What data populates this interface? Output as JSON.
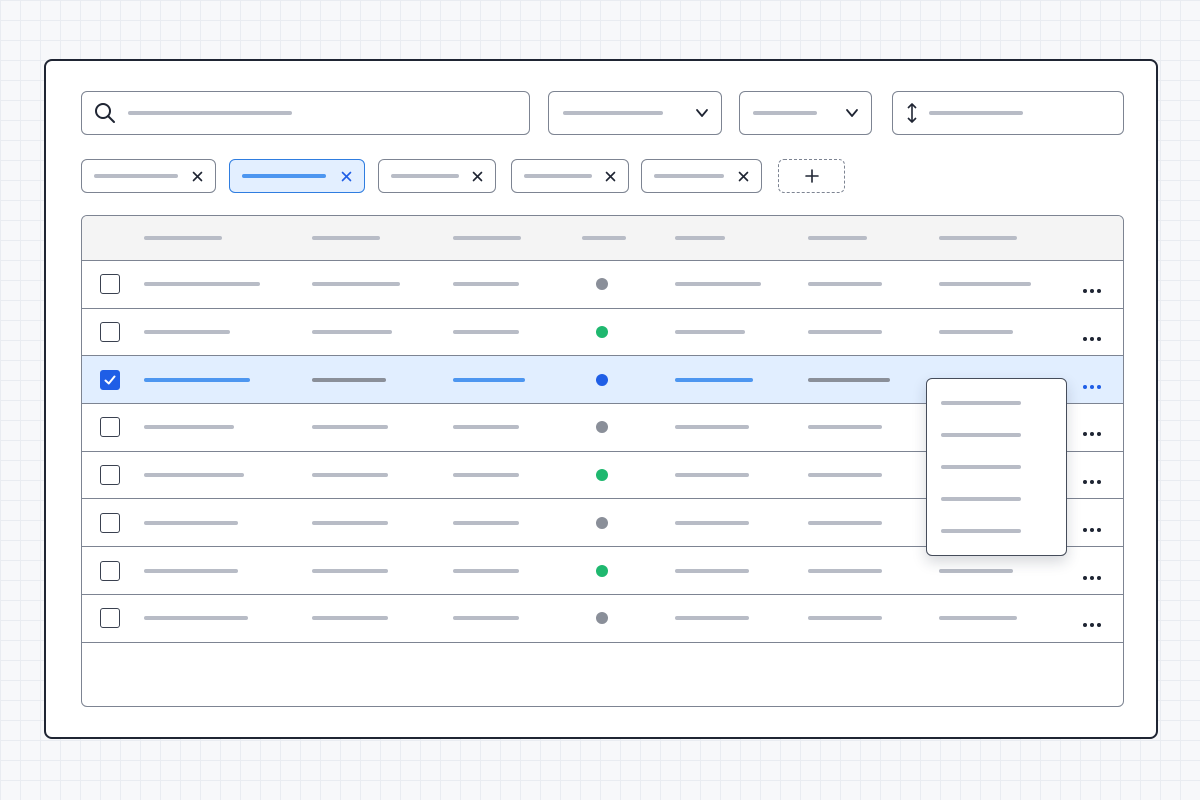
{
  "toolbar": {
    "search": {
      "icon": "search-icon",
      "value": ""
    },
    "filter_dropdown_1": {
      "icon": "chevron-down-icon",
      "value": ""
    },
    "filter_dropdown_2": {
      "icon": "chevron-down-icon",
      "value": ""
    },
    "sort_control": {
      "icon": "sort-arrows-icon",
      "value": ""
    }
  },
  "filter_chips": [
    {
      "active": false,
      "remove_icon": "close-icon"
    },
    {
      "active": true,
      "remove_icon": "close-icon"
    },
    {
      "active": false,
      "remove_icon": "close-icon"
    },
    {
      "active": false,
      "remove_icon": "close-icon"
    },
    {
      "active": false,
      "remove_icon": "close-icon"
    }
  ],
  "add_filter": {
    "icon": "plus-icon"
  },
  "table": {
    "rows": [
      {
        "checked": false,
        "status": "neutral"
      },
      {
        "checked": false,
        "status": "active"
      },
      {
        "checked": true,
        "status": "selected"
      },
      {
        "checked": false,
        "status": "neutral"
      },
      {
        "checked": false,
        "status": "active"
      },
      {
        "checked": false,
        "status": "neutral"
      },
      {
        "checked": false,
        "status": "active"
      },
      {
        "checked": false,
        "status": "neutral"
      }
    ],
    "row_action_icon": "more-horizontal-icon"
  },
  "row_menu": {
    "open_on_row": 3,
    "item_count": 5
  },
  "colors": {
    "accent": "#1f5ee6",
    "status_neutral": "#8a8f99",
    "status_active": "#1fb86f",
    "status_selected": "#1f5ee6",
    "selection_bg": "#e1eeff",
    "placeholder": "#b8bcc6"
  }
}
